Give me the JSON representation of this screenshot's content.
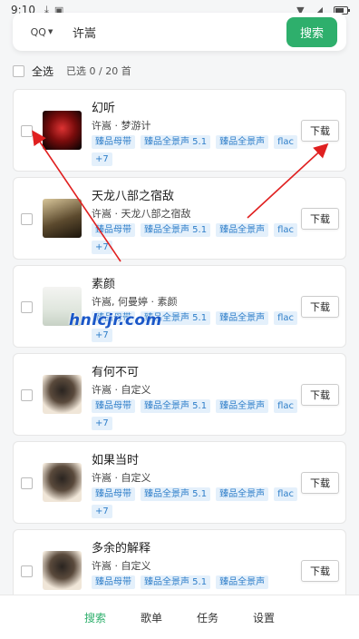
{
  "status_bar": {
    "time": "9:10",
    "icons": [
      "download-icon",
      "app-a-icon",
      "wifi-icon",
      "signal-icon",
      "battery-icon"
    ]
  },
  "search": {
    "source": "QQ",
    "query": "许嵩",
    "button_label": "搜索"
  },
  "selection": {
    "select_all_label": "全选",
    "count_text": "已选 0 / 20 首"
  },
  "songs": [
    {
      "title": "幻听",
      "meta": "许嵩 · 梦游计",
      "tags": [
        "臻品母带",
        "臻品全景声 5.1",
        "臻品全景声",
        "flac",
        "+7"
      ],
      "download_label": "下载",
      "cover_icon": "album-cover-icon"
    },
    {
      "title": "天龙八部之宿敌",
      "meta": "许嵩 · 天龙八部之宿敌",
      "tags": [
        "臻品母带",
        "臻品全景声 5.1",
        "臻品全景声",
        "flac",
        "+7"
      ],
      "download_label": "下载",
      "cover_icon": "album-cover-icon"
    },
    {
      "title": "素颜",
      "meta": "许嵩, 何曼婷 · 素颜",
      "tags": [
        "臻品母带",
        "臻品全景声 5.1",
        "臻品全景声",
        "flac",
        "+7"
      ],
      "download_label": "下载",
      "cover_icon": "album-cover-icon"
    },
    {
      "title": "有何不可",
      "meta": "许嵩 · 自定义",
      "tags": [
        "臻品母带",
        "臻品全景声 5.1",
        "臻品全景声",
        "flac",
        "+7"
      ],
      "download_label": "下载",
      "cover_icon": "album-cover-icon"
    },
    {
      "title": "如果当时",
      "meta": "许嵩 · 自定义",
      "tags": [
        "臻品母带",
        "臻品全景声 5.1",
        "臻品全景声",
        "flac",
        "+7"
      ],
      "download_label": "下载",
      "cover_icon": "album-cover-icon"
    },
    {
      "title": "多余的解释",
      "meta": "许嵩 · 自定义",
      "tags": [
        "臻品母带",
        "臻品全景声 5.1",
        "臻品全景声"
      ],
      "download_label": "下载",
      "cover_icon": "album-cover-icon"
    }
  ],
  "watermark": "hnlcjr.com",
  "bottom_nav": [
    "搜索",
    "歌单",
    "任务",
    "设置"
  ],
  "colors": {
    "accent": "#2eaf6c",
    "tag_text": "#2e7ec9",
    "tag_bg": "#e4f0fb",
    "annotation_arrow": "#e02020"
  }
}
